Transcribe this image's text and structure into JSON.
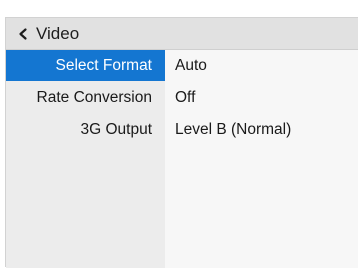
{
  "header": {
    "title": "Video",
    "back_icon": "chevron-left-icon"
  },
  "settings": [
    {
      "label": "Select Format",
      "value": "Auto",
      "selected": true
    },
    {
      "label": "Rate Conversion",
      "value": "Off",
      "selected": false
    },
    {
      "label": "3G Output",
      "value": "Level B (Normal)",
      "selected": false
    }
  ],
  "colors": {
    "selected_bg": "#1476d1",
    "selected_text": "#ffffff",
    "text": "#1a1a1a",
    "header_bg": "#e1e1e1",
    "left_bg": "#ececec",
    "right_bg": "#f7f7f7"
  }
}
